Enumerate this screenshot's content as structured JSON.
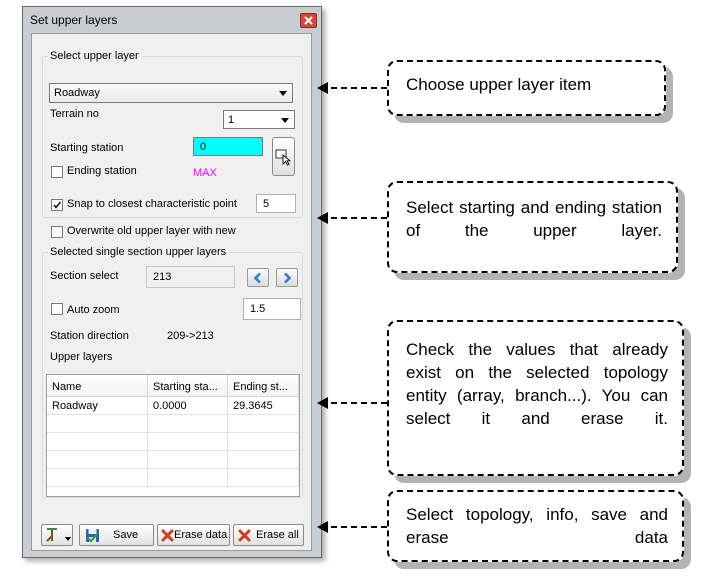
{
  "dialog": {
    "title": "Set upper layers",
    "select_group_label": "Select upper layer",
    "layer_combo_value": "Roadway",
    "terrain_no_label": "Terrain no",
    "terrain_combo_value": "1",
    "starting_station_label": "Starting station",
    "starting_station_value": "0",
    "ending_station_label": "Ending station",
    "ending_station_value": "MAX",
    "snap_label": "Snap to closest characteristic point",
    "snap_checked": true,
    "snap_value": "5",
    "overwrite_label": "Overwrite old upper layer with new",
    "overwrite_checked": false,
    "single_section_group_label": "Selected single section upper layers",
    "section_select_label": "Section select",
    "section_select_value": "213",
    "auto_zoom_label": "Auto zoom",
    "auto_zoom_checked": false,
    "auto_zoom_value": "1.5",
    "station_direction_label": "Station direction",
    "station_direction_value": "209->213",
    "upper_layers_label": "Upper layers",
    "grid": {
      "columns": [
        "Name",
        "Starting sta...",
        "Ending st..."
      ],
      "rows": [
        [
          "Roadway",
          "0.0000",
          "29.3645"
        ]
      ]
    },
    "buttons": {
      "save": "Save",
      "erase_data": "Erase data",
      "erase_all": "Erase all"
    },
    "colors": {
      "starting_station_bg": "#00ffff",
      "ending_station_text": "#ff00ff",
      "nav_arrow": "#2a7fd4",
      "close_button": "#d24a3a"
    }
  },
  "callouts": {
    "choose_item": "Choose upper layer item",
    "select_stations": "Select starting and ending station of the upper layer.",
    "check_values": "Check the values that already exist on the selected topology entity (array, branch...). You can select it and erase it.",
    "select_topology": "Select topology, info, save and erase data"
  }
}
